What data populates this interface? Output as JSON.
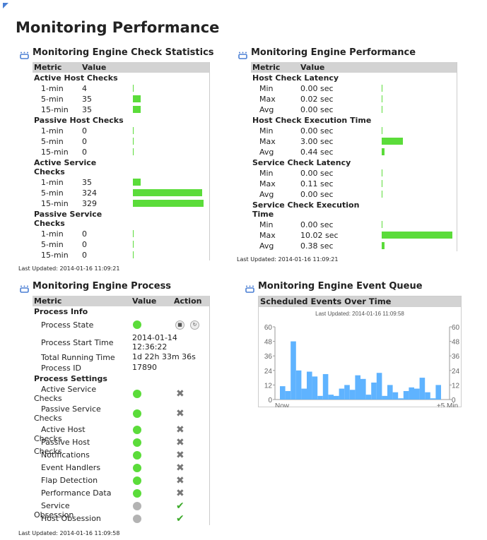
{
  "page_title": "Monitoring Performance",
  "colors": {
    "bar": "#5bdc3a",
    "chart_bar": "#5fb3ff",
    "enabled": "#5bdc3a",
    "disabled": "#b3b3b3"
  },
  "check_stats": {
    "title": "Monitoring Engine Check Statistics",
    "col_metric": "Metric",
    "col_value": "Value",
    "sections": [
      {
        "label": "Active Host Checks",
        "rows": [
          {
            "m": "1-min",
            "v": "4",
            "n": 4
          },
          {
            "m": "5-min",
            "v": "35",
            "n": 35
          },
          {
            "m": "15-min",
            "v": "35",
            "n": 35
          }
        ]
      },
      {
        "label": "Passive Host Checks",
        "rows": [
          {
            "m": "1-min",
            "v": "0",
            "n": 0
          },
          {
            "m": "5-min",
            "v": "0",
            "n": 0
          },
          {
            "m": "15-min",
            "v": "0",
            "n": 0
          }
        ]
      },
      {
        "label": "Active Service Checks",
        "rows": [
          {
            "m": "1-min",
            "v": "35",
            "n": 35
          },
          {
            "m": "5-min",
            "v": "324",
            "n": 324
          },
          {
            "m": "15-min",
            "v": "329",
            "n": 329
          }
        ]
      },
      {
        "label": "Passive Service Checks",
        "rows": [
          {
            "m": "1-min",
            "v": "0",
            "n": 0
          },
          {
            "m": "5-min",
            "v": "0",
            "n": 0
          },
          {
            "m": "15-min",
            "v": "0",
            "n": 0
          }
        ]
      }
    ],
    "last_updated": "Last Updated: 2014-01-16 11:09:21"
  },
  "engine_perf": {
    "title": "Monitoring Engine Performance",
    "col_metric": "Metric",
    "col_value": "Value",
    "sections": [
      {
        "label": "Host Check Latency",
        "rows": [
          {
            "m": "Min",
            "v": "0.00 sec",
            "n": 0
          },
          {
            "m": "Max",
            "v": "0.02 sec",
            "n": 0.02
          },
          {
            "m": "Avg",
            "v": "0.00 sec",
            "n": 0
          }
        ]
      },
      {
        "label": "Host Check Execution Time",
        "rows": [
          {
            "m": "Min",
            "v": "0.00 sec",
            "n": 0
          },
          {
            "m": "Max",
            "v": "3.00 sec",
            "n": 3
          },
          {
            "m": "Avg",
            "v": "0.44 sec",
            "n": 0.44
          }
        ]
      },
      {
        "label": "Service Check Latency",
        "rows": [
          {
            "m": "Min",
            "v": "0.00 sec",
            "n": 0
          },
          {
            "m": "Max",
            "v": "0.11 sec",
            "n": 0.11
          },
          {
            "m": "Avg",
            "v": "0.00 sec",
            "n": 0
          }
        ]
      },
      {
        "label": "Service Check Execution Time",
        "rows": [
          {
            "m": "Min",
            "v": "0.00 sec",
            "n": 0
          },
          {
            "m": "Max",
            "v": "10.02 sec",
            "n": 10.02
          },
          {
            "m": "Avg",
            "v": "0.38 sec",
            "n": 0.38
          }
        ]
      }
    ],
    "last_updated": "Last Updated: 2014-01-16 11:09:21"
  },
  "process": {
    "title": "Monitoring Engine Process",
    "col_metric": "Metric",
    "col_value": "Value",
    "col_action": "Action",
    "info_label": "Process Info",
    "info": [
      {
        "m": "Process State",
        "state": "running"
      },
      {
        "m": "Process Start Time",
        "v": "2014-01-14 12:36:22"
      },
      {
        "m": "Total Running Time",
        "v": "1d 22h 33m 36s"
      },
      {
        "m": "Process ID",
        "v": "17890"
      }
    ],
    "settings_label": "Process Settings",
    "settings": [
      {
        "m": "Active Service Checks",
        "on": true
      },
      {
        "m": "Passive Service Checks",
        "on": true
      },
      {
        "m": "Active Host Checks",
        "on": true
      },
      {
        "m": "Passive Host Checks",
        "on": true
      },
      {
        "m": "Notifications",
        "on": true
      },
      {
        "m": "Event Handlers",
        "on": true
      },
      {
        "m": "Flap Detection",
        "on": true
      },
      {
        "m": "Performance Data",
        "on": true
      },
      {
        "m": "Service Obsession",
        "on": false
      },
      {
        "m": "Host Obsession",
        "on": false
      }
    ],
    "last_updated": "Last Updated: 2014-01-16 11:09:58"
  },
  "event_queue": {
    "title": "Monitoring Engine Event Queue"
  },
  "chart_data": {
    "type": "bar",
    "title": "Scheduled Events Over Time",
    "subtitle": "Last Updated: 2014-01-16 11:09:58",
    "x_labels": [
      "Now",
      "+5 Min"
    ],
    "ylim": [
      0,
      60
    ],
    "yticks": [
      0,
      12,
      24,
      36,
      48,
      60
    ],
    "values": [
      11,
      7,
      48,
      24,
      9,
      23,
      19,
      3,
      21,
      4,
      3,
      9,
      12,
      8,
      20,
      17,
      4,
      14,
      22,
      3,
      12,
      6,
      1,
      7,
      10,
      9,
      18,
      6,
      1,
      12
    ]
  }
}
